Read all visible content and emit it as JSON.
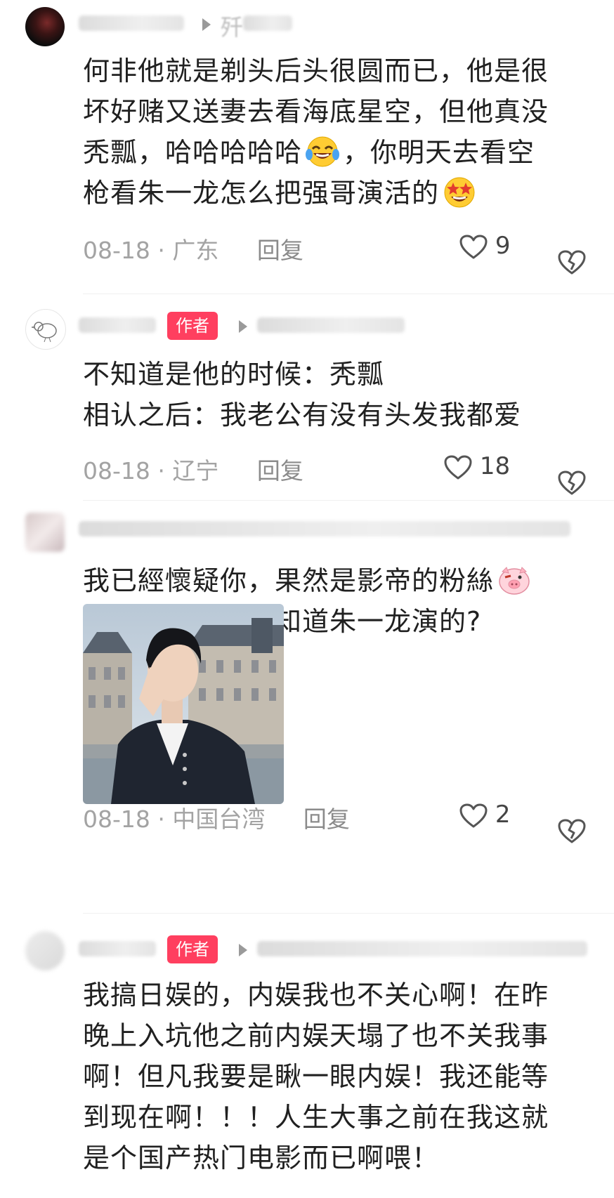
{
  "comments": [
    {
      "lines": [
        "何非他就是剃头后头很圆而已，他是很",
        "坏好赌又送妻去看海底星空，但他真没",
        "秃瓢，哈哈哈哈哈",
        "，你明天去看空",
        "枪看朱一龙怎么把强哥演活的"
      ],
      "date": "08-18",
      "region": "广东",
      "reply": "回复",
      "likes": "9",
      "name_fragment": "歼"
    },
    {
      "badge": "作者",
      "lines": [
        "不知道是他的时候：秃瓢",
        "相认之后：我老公有没有头发我都爱"
      ],
      "date": "08-18",
      "region": "辽宁",
      "reply": "回复",
      "likes": "18"
    },
    {
      "lines": [
        "我已經懷疑你，果然是影帝的粉絲",
        "人生大事你也不知道朱一龙演的?"
      ],
      "date": "08-18",
      "region": "中国台湾",
      "reply": "回复",
      "likes": "2"
    },
    {
      "badge": "作者",
      "lines": [
        "我搞日娱的，内娱我也不关心啊！在昨",
        "晚上入坑他之前内娱天塌了也不关我事",
        "啊！但凡我要是瞅一眼内娱！我还能等",
        "到现在啊！！！人生大事之前在我这就",
        "是个国产热门电影而已啊喂！"
      ]
    }
  ],
  "icons": {
    "like": "heart-outline-icon",
    "dislike": "broken-heart-icon",
    "reply_arrow": "triangle-right-icon",
    "emoji_laugh": "tears-of-joy-emoji",
    "emoji_star": "star-struck-emoji",
    "emoji_pig": "pig-face-emoji"
  },
  "colors": {
    "badge": "#ff3f5f",
    "meta": "#a3a3a3",
    "text": "#202020"
  }
}
